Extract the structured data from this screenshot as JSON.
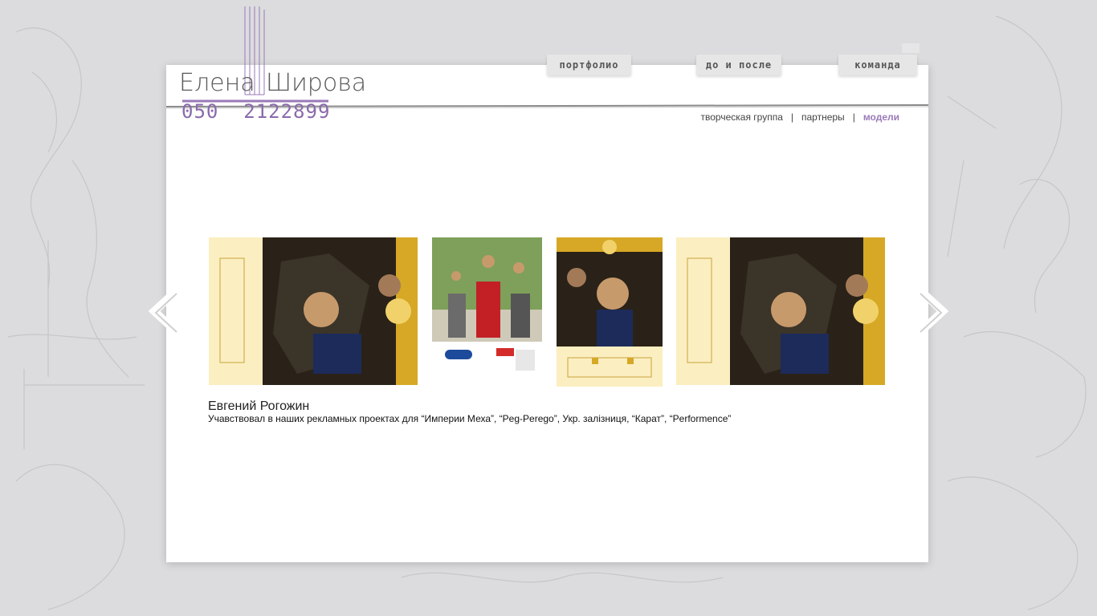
{
  "logo": {
    "name_part1": "Елена",
    "name_part2": "Широва",
    "phone": "050  2122899"
  },
  "main_nav": {
    "items": [
      {
        "label": "портфолио"
      },
      {
        "label": "до и после"
      },
      {
        "label": "команда"
      }
    ]
  },
  "sub_nav": {
    "items": [
      {
        "label": "творческая группа",
        "active": false
      },
      {
        "label": "партнеры",
        "active": false
      },
      {
        "label": "модели",
        "active": true
      }
    ],
    "separator": "|"
  },
  "gallery": {
    "thumbnails": [
      {
        "description": "calendar-page-horizontal"
      },
      {
        "description": "peg-perego-ad"
      },
      {
        "description": "calendar-page-vertical"
      },
      {
        "description": "calendar-page-horizontal"
      }
    ]
  },
  "model": {
    "name": "Евгений Рогожин",
    "description": "Учавствовал в наших рекламных проектах для “Империи Меха”, “Peg-Perego”, Укр. залізниця, “Карат”, “Performence”"
  },
  "colors": {
    "accent": "#9a7ab8",
    "background": "#dcdcde",
    "panel": "#ffffff",
    "calendar_gold": "#d6a825",
    "calendar_cream": "#fbeec0"
  }
}
